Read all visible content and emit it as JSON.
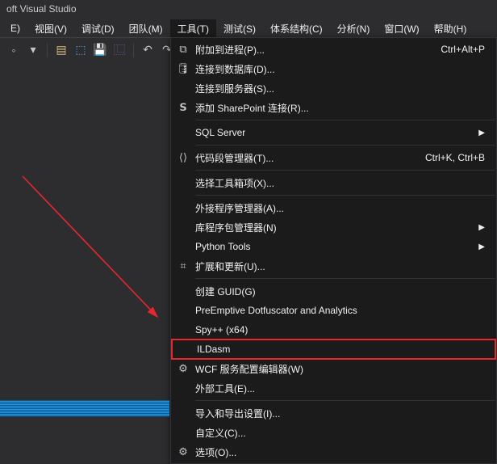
{
  "title": "oft Visual Studio",
  "menu": {
    "items": [
      {
        "label": "E)"
      },
      {
        "label": "视图(V)"
      },
      {
        "label": "调试(D)"
      },
      {
        "label": "团队(M)"
      },
      {
        "label": "工具(T)",
        "open": true
      },
      {
        "label": "测试(S)"
      },
      {
        "label": "体系结构(C)"
      },
      {
        "label": "分析(N)"
      },
      {
        "label": "窗口(W)"
      },
      {
        "label": "帮助(H)"
      }
    ]
  },
  "dropdown": {
    "groups": [
      [
        {
          "icon": "⧉",
          "label": "附加到进程(P)...",
          "shortcut": "Ctrl+Alt+P"
        },
        {
          "icon": "🛢",
          "label": "连接到数据库(D)..."
        },
        {
          "icon": "",
          "label": "连接到服务器(S)..."
        },
        {
          "icon": "𝗦",
          "label": "添加 SharePoint 连接(R)..."
        }
      ],
      [
        {
          "icon": "",
          "label": "SQL Server",
          "arrow": true
        }
      ],
      [
        {
          "icon": "⟨⟩",
          "label": "代码段管理器(T)...",
          "shortcut": "Ctrl+K, Ctrl+B"
        }
      ],
      [
        {
          "icon": "",
          "label": "选择工具箱项(X)..."
        }
      ],
      [
        {
          "icon": "",
          "label": "外接程序管理器(A)..."
        },
        {
          "icon": "",
          "label": "库程序包管理器(N)",
          "arrow": true
        },
        {
          "icon": "",
          "label": "Python Tools",
          "arrow": true
        },
        {
          "icon": "⌗",
          "label": "扩展和更新(U)..."
        }
      ],
      [
        {
          "icon": "",
          "label": "创建 GUID(G)"
        },
        {
          "icon": "",
          "label": "PreEmptive Dotfuscator and Analytics"
        },
        {
          "icon": "",
          "label": "Spy++ (x64)"
        },
        {
          "icon": "",
          "label": "ILDasm",
          "highlight": true
        },
        {
          "icon": "⚙",
          "label": "WCF 服务配置编辑器(W)"
        },
        {
          "icon": "",
          "label": "外部工具(E)..."
        }
      ],
      [
        {
          "icon": "",
          "label": "导入和导出设置(I)..."
        },
        {
          "icon": "",
          "label": "自定义(C)..."
        },
        {
          "icon": "⚙",
          "label": "选项(O)..."
        }
      ]
    ]
  }
}
